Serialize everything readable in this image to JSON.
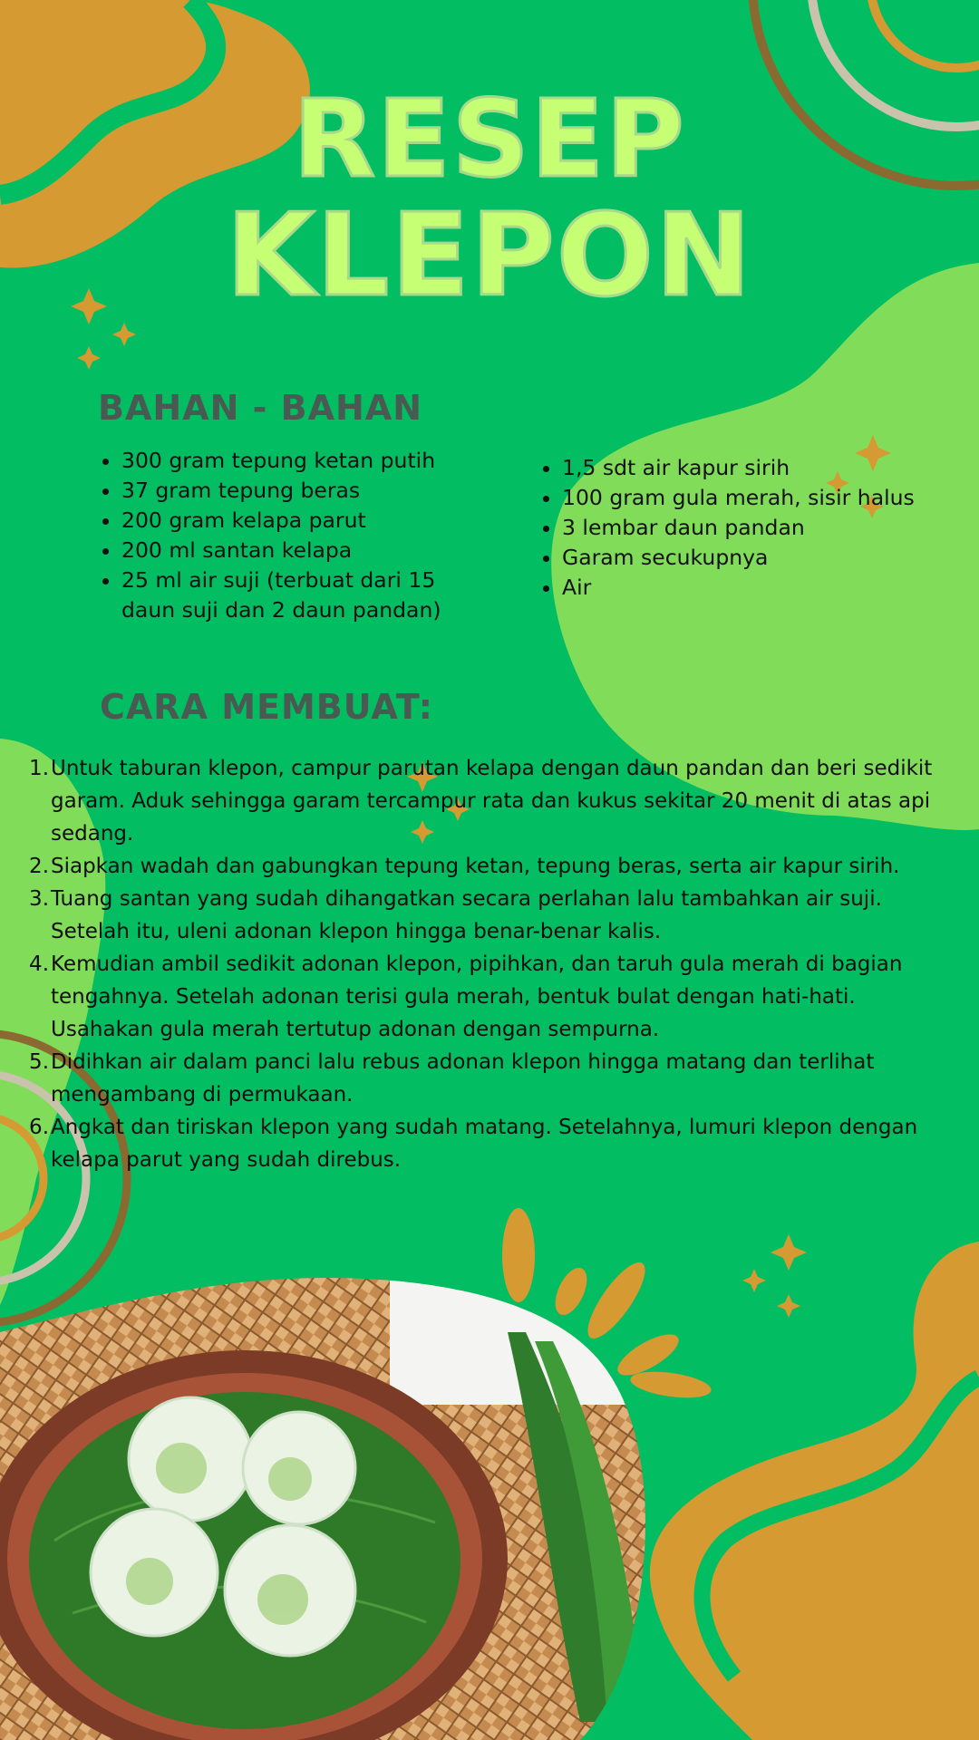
{
  "title": {
    "line1": "RESEP",
    "line2": "KLEPON"
  },
  "ingredients": {
    "heading": "BAHAN - BAHAN",
    "left": [
      "300 gram tepung ketan putih",
      "37 gram tepung beras",
      "200 gram kelapa parut",
      "200 ml santan kelapa",
      "25 ml air suji (terbuat dari 15 daun suji dan 2 daun pandan)"
    ],
    "right": [
      "1,5 sdt air kapur sirih",
      "100 gram gula merah, sisir halus",
      "3 lembar daun pandan",
      "Garam secukupnya",
      "Air"
    ]
  },
  "method": {
    "heading": "CARA MEMBUAT:",
    "steps": [
      "Untuk taburan klepon, campur parutan kelapa dengan daun pandan dan beri sedikit garam. Aduk sehingga garam tercampur rata dan kukus sekitar 20 menit di atas api sedang.",
      "Siapkan wadah dan gabungkan tepung ketan, tepung beras, serta air kapur sirih.",
      "Tuang santan yang sudah dihangatkan secara perlahan lalu tambahkan air suji. Setelah itu, uleni adonan klepon hingga benar-benar kalis.",
      "Kemudian ambil sedikit adonan klepon, pipihkan, dan taruh gula merah di bagian tengahnya. Setelah adonan terisi gula merah, bentuk bulat dengan hati-hati. Usahakan gula merah tertutup adonan dengan sempurna.",
      "Didihkan air dalam panci lalu rebus adonan klepon hingga matang dan terlihat mengambang di permukaan.",
      "Angkat dan tiriskan klepon yang sudah matang. Setelahnya, lumuri klepon dengan kelapa parut yang sudah direbus."
    ]
  },
  "colors": {
    "background": "#02bd62",
    "light_green": "#80dc59",
    "orange": "#d59a32",
    "title": "#c6ff74",
    "heading": "#4a5a52"
  },
  "icons": [
    "sparkle-icon",
    "swirl-decoration",
    "rainbow-arc-decoration",
    "burst-decoration"
  ],
  "image": "klepon-photo"
}
